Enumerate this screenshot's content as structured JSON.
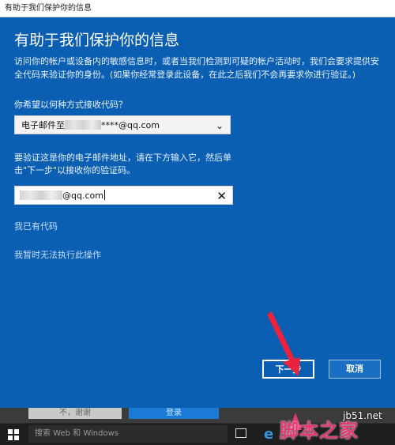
{
  "window": {
    "title": "有助于我们保护你的信息"
  },
  "dialog": {
    "heading": "有助于我们保护你的信息",
    "description": "访问你的帐户或设备内的敏感信息时，或者当我们检测到可疑的帐户活动时，我们会要求提供安全代码来验证你的身份。(如果你经常登录此设备，在此之后我们不会再要求你进行验证。)",
    "method_question": "你希望以何种方式接收代码？",
    "method_select": {
      "prefix": "电子邮件至",
      "suffix": "****@qq.com"
    },
    "verify_instruction": "要验证这是你的电子邮件地址，请在下方输入它，然后单击\"下一步\"以接收你的验证码。",
    "email_input": {
      "value_suffix": "@qq.com"
    },
    "link_have_code": "我已有代码",
    "link_cannot_do": "我暂时无法执行此操作",
    "next_button": "下一步",
    "cancel_button": "取消"
  },
  "background_window": {
    "left_button": "不，谢谢",
    "right_button": "登录"
  },
  "taskbar": {
    "search_placeholder": "搜索 Web 和 Windows",
    "edge_glyph": "e"
  },
  "watermark": {
    "text": "脚本之家",
    "site": "jb51.net"
  },
  "colors": {
    "dialog_bg": "#0b5fb3",
    "annotation_arrow": "#e8233b",
    "watermark": "#e23b72"
  }
}
